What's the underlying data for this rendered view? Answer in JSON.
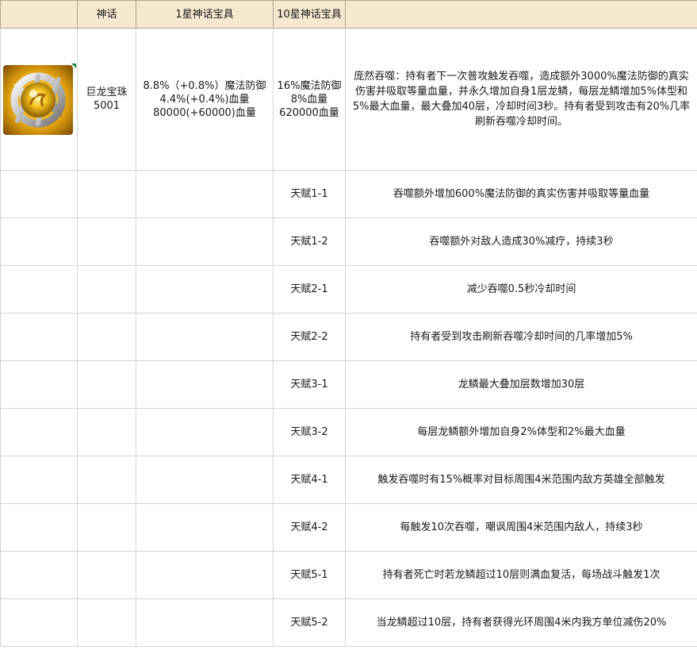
{
  "header": {
    "col_icon": "",
    "col_myth": "神话",
    "col_star1": "1星神话宝具",
    "col_star10": "10星神话宝具",
    "col_desc": ""
  },
  "item": {
    "icon": "golden-dragon-orb-icon",
    "name": "巨龙宝珠",
    "id": "5001",
    "star1_line1": "8.8%（+0.8%）魔法防御",
    "star1_line2": "4.4%(+0.4%)血量",
    "star1_line3": "80000(+60000)血量",
    "star10_line1": "16%魔法防御",
    "star10_line2": "8%血量",
    "star10_line3": "620000血量",
    "skill_desc": "庞然吞噬：持有者下一次普攻触发吞噬，造成额外3000%魔法防御的真实伤害并吸取等量血量，并永久增加自身1层龙鳞，每层龙鳞增加5%体型和5%最大血量，最大叠加40层，冷却时间3秒。持有者受到攻击有20%几率刷新吞噬冷却时间。"
  },
  "talents": [
    {
      "name": "天赋1-1",
      "desc": "吞噬额外增加600%魔法防御的真实伤害并吸取等量血量"
    },
    {
      "name": "天赋1-2",
      "desc": "吞噬额外对敌人造成30%减疗，持续3秒"
    },
    {
      "name": "天赋2-1",
      "desc": "减少吞噬0.5秒冷却时间"
    },
    {
      "name": "天赋2-2",
      "desc": "持有者受到攻击刷新吞噬冷却时间的几率增加5%"
    },
    {
      "name": "天赋3-1",
      "desc": "龙鳞最大叠加层数增加30层"
    },
    {
      "name": "天赋3-2",
      "desc": "每层龙鳞额外增加自身2%体型和2%最大血量"
    },
    {
      "name": "天赋4-1",
      "desc": "触发吞噬时有15%概率对目标周围4米范围内敌方英雄全部触发"
    },
    {
      "name": "天赋4-2",
      "desc": "每触发10次吞噬，嘲讽周围4米范围内敌人，持续3秒"
    },
    {
      "name": "天赋5-1",
      "desc": "持有者死亡时若龙鳞超过10层则满血复活，每场战斗触发1次"
    },
    {
      "name": "天赋5-2",
      "desc": "当龙鳞超过10层，持有者获得光环周围4米内我方单位减伤20%"
    }
  ],
  "colors": {
    "header_bg": "#f6e7cf",
    "grid_line": "#d4d4d4",
    "icon_gold": "#e8b21a",
    "icon_silver": "#c9c9c9"
  }
}
